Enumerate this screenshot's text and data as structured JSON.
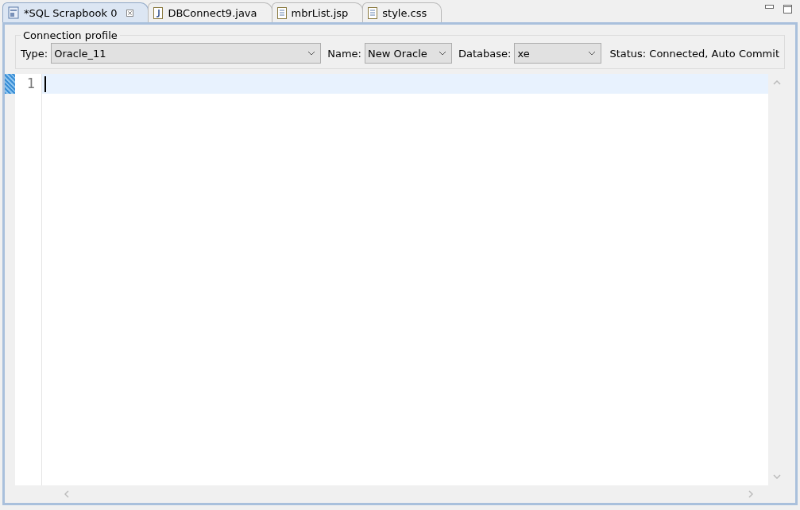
{
  "tabs": [
    {
      "label": "*SQL Scrapbook 0",
      "kind": "sql",
      "selected": true
    },
    {
      "label": "DBConnect9.java",
      "kind": "java",
      "selected": false
    },
    {
      "label": "mbrList.jsp",
      "kind": "file",
      "selected": false
    },
    {
      "label": "style.css",
      "kind": "file",
      "selected": false
    }
  ],
  "connection_profile": {
    "title": "Connection profile",
    "fields": [
      {
        "label": "Type:",
        "value": "Oracle_11"
      },
      {
        "label": "Name:",
        "value": "New Oracle"
      },
      {
        "label": "Database:",
        "value": "xe"
      }
    ],
    "status": "Status: Connected, Auto Commit"
  },
  "editor": {
    "line_numbers": [
      "1"
    ]
  }
}
